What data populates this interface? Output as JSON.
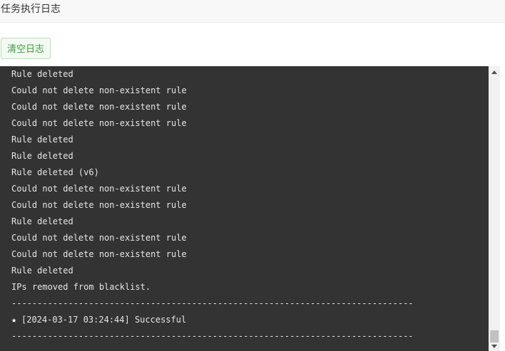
{
  "header": {
    "title": "任务执行日志"
  },
  "toolbar": {
    "clear_label": "清空日志"
  },
  "log": {
    "lines": [
      "Rule deleted",
      "Could not delete non-existent rule",
      "Could not delete non-existent rule",
      "Could not delete non-existent rule",
      "Rule deleted",
      "Rule deleted",
      "Rule deleted (v6)",
      "Could not delete non-existent rule",
      "Could not delete non-existent rule",
      "Rule deleted",
      "Could not delete non-existent rule",
      "Could not delete non-existent rule",
      "Rule deleted",
      "IPs removed from blacklist.",
      "------------------------------------------------------------------------------",
      "[2024-03-17 03:24:44] Successful",
      "------------------------------------------------------------------------------"
    ],
    "status_icon": "star-icon",
    "status_line_index": 15
  },
  "scrollbar": {
    "up_icon": "scroll-up-arrow-icon",
    "down_icon": "scroll-down-arrow-icon"
  },
  "colors": {
    "log_background": "#333333",
    "log_text": "#e6e6e6",
    "button_text": "#3e9a3e",
    "button_border": "#b9dfb9"
  }
}
